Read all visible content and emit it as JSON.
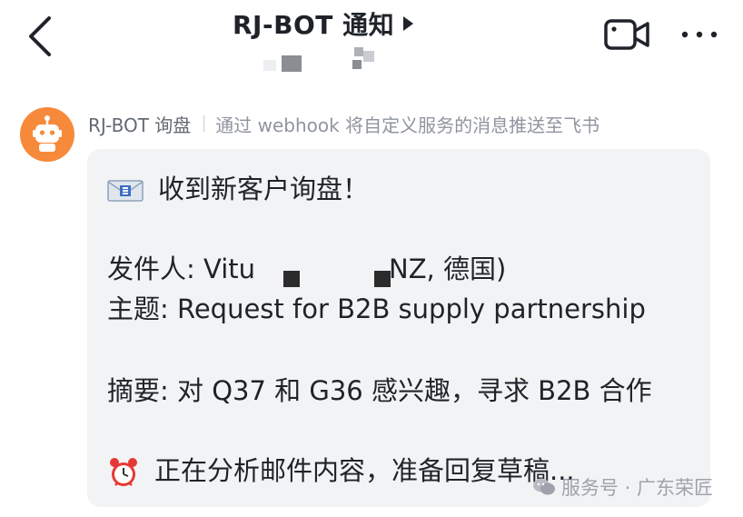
{
  "header": {
    "title": "RJ-BOT 通知"
  },
  "message": {
    "sender_name": "RJ-BOT 询盘",
    "sender_description": "通过 webhook 将自定义服务的消息推送至飞书",
    "lines": {
      "title": "收到新客户询盘！",
      "sender_label": "发件人: Vitu",
      "sender_tail": "NZ, 德国)",
      "subject": "主题: Request for B2B supply partnership",
      "summary": "摘要: 对 Q37 和 G36 感兴趣，寻求 B2B 合作",
      "status": "正在分析邮件内容，准备回复草稿..."
    }
  },
  "watermark": {
    "text": "服务号 · 广东荣匠"
  },
  "icons": {
    "back": "chevron-left-icon",
    "title_arrow": "triangle-right-icon",
    "video": "video-camera-icon",
    "more": "more-dots-icon",
    "avatar": "robot-icon",
    "envelope": "envelope-icon",
    "clock": "alarm-clock-icon",
    "wechat": "wechat-icon"
  },
  "colors": {
    "avatar_bg": "#f7893b",
    "bubble_bg": "#f2f3f5",
    "link_underline": "#3370ff",
    "alarm_red": "#e53935"
  }
}
